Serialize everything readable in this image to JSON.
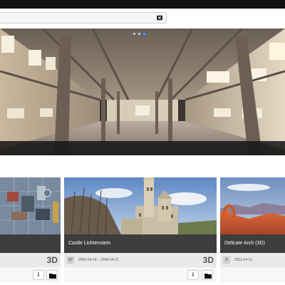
{
  "header": {
    "search": {
      "placeholder": "",
      "value": ""
    },
    "clear_icon": "close-icon"
  },
  "hero": {
    "carousel_dots": 3,
    "active_dot": 2,
    "image_description_icon": "panorama-photo"
  },
  "gallery": {
    "cards": [
      {
        "title": "",
        "number": "",
        "dates": "",
        "badge": "3D",
        "info_label": "i",
        "folder_icon": "folder-icon"
      },
      {
        "title": "Castle Lichtenstein",
        "number": "87",
        "dates": "2009-04-19 – 2009-04-21",
        "badge": "3D",
        "info_label": "i",
        "folder_icon": "folder-icon"
      },
      {
        "title": "Delicate Arch (3D)",
        "number": "4",
        "dates": "2011-04-12",
        "badge": "",
        "info_label": "",
        "folder_icon": ""
      }
    ]
  },
  "colors": {
    "topbar": "#101010",
    "title_bar": "#3d3d3d",
    "active_dot": "#4da3ff"
  }
}
